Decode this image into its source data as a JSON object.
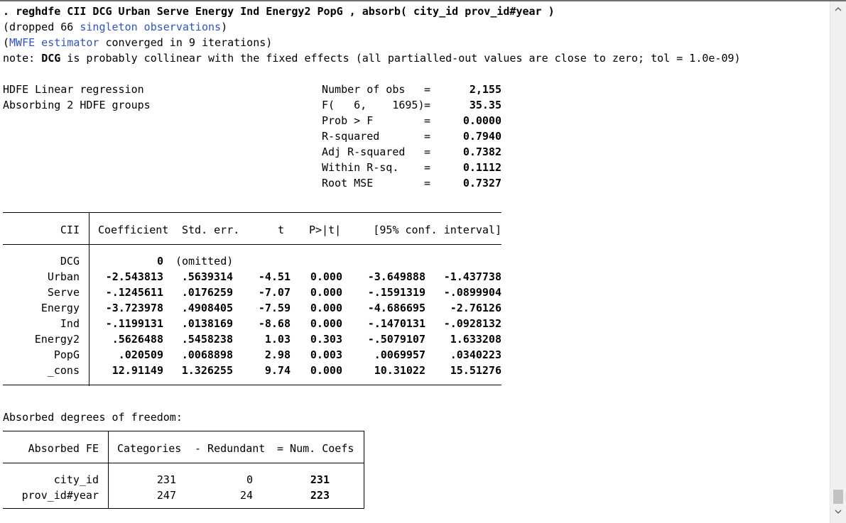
{
  "command": {
    "prefix": ". ",
    "text": "reghdfe CII DCG Urban Serve Energy Ind Energy2 PopG , absorb( city_id prov_id#year )"
  },
  "messages": {
    "dropped_pre": "(dropped 66 ",
    "dropped_link": "singleton observations",
    "dropped_post": ")",
    "mwfe_pre": "(",
    "mwfe_link": "MWFE estimator",
    "mwfe_post": " converged in 9 iterations)",
    "note_pre": "note: ",
    "note_var": "DCG",
    "note_post": " is probably collinear with the fixed effects (all partialled-out values are close to zero; tol = 1.0e-09)"
  },
  "header": {
    "title": "HDFE Linear regression",
    "subtitle": "Absorbing 2 HDFE groups",
    "stats": [
      {
        "label": "Number of obs",
        "eq": "=",
        "value": "2,155"
      },
      {
        "label": "F(   6,    1695)",
        "eq": "=",
        "value": "35.35"
      },
      {
        "label": "Prob > F",
        "eq": "=",
        "value": "0.0000"
      },
      {
        "label": "R-squared",
        "eq": "=",
        "value": "0.7940"
      },
      {
        "label": "Adj R-squared",
        "eq": "=",
        "value": "0.7382"
      },
      {
        "label": "Within R-sq.",
        "eq": "=",
        "value": "0.1112"
      },
      {
        "label": "Root MSE",
        "eq": "=",
        "value": "0.7327"
      }
    ]
  },
  "coef_table": {
    "depvar": "CII",
    "headers": {
      "coef": "Coefficient",
      "se": "Std. err.",
      "t": "t",
      "p": "P>|t|",
      "ci": "[95% conf. interval]"
    },
    "rows": [
      {
        "var": "DCG",
        "coef": "0",
        "se": "(omitted)",
        "t": "",
        "p": "",
        "lo": "",
        "hi": ""
      },
      {
        "var": "Urban",
        "coef": "-2.543813",
        "se": ".5639314",
        "t": "-4.51",
        "p": "0.000",
        "lo": "-3.649888",
        "hi": "-1.437738"
      },
      {
        "var": "Serve",
        "coef": "-.1245611",
        "se": ".0176259",
        "t": "-7.07",
        "p": "0.000",
        "lo": "-.1591319",
        "hi": "-.0899904"
      },
      {
        "var": "Energy",
        "coef": "-3.723978",
        "se": ".4908405",
        "t": "-7.59",
        "p": "0.000",
        "lo": "-4.686695",
        "hi": "-2.76126"
      },
      {
        "var": "Ind",
        "coef": "-.1199131",
        "se": ".0138169",
        "t": "-8.68",
        "p": "0.000",
        "lo": "-.1470131",
        "hi": "-.0928132"
      },
      {
        "var": "Energy2",
        "coef": ".5626488",
        "se": ".5458238",
        "t": "1.03",
        "p": "0.303",
        "lo": "-.5079107",
        "hi": "1.633208"
      },
      {
        "var": "PopG",
        "coef": ".020509",
        "se": ".0068898",
        "t": "2.98",
        "p": "0.003",
        "lo": ".0069957",
        "hi": ".0340223"
      },
      {
        "var": "_cons",
        "coef": "12.91149",
        "se": "1.326255",
        "t": "9.74",
        "p": "0.000",
        "lo": "10.31022",
        "hi": "15.51276"
      }
    ]
  },
  "absorbed": {
    "title": "Absorbed degrees of freedom:",
    "headers": {
      "fe": "Absorbed FE",
      "cat": "Categories",
      "red": "- Redundant",
      "num": "= Num. Coefs"
    },
    "rows": [
      {
        "fe": "city_id",
        "cat": "231",
        "red": "0",
        "num": "231"
      },
      {
        "fe": "prov_id#year",
        "cat": "247",
        "red": "24",
        "num": "223"
      }
    ]
  },
  "scrollbar": {
    "up_icon": "chevron-up-icon",
    "down_icon": "chevron-down-icon"
  }
}
